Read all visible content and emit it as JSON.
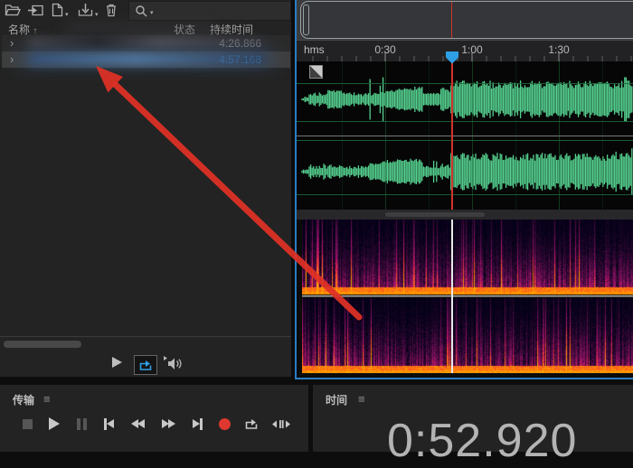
{
  "files_panel": {
    "toolbar": {
      "icons": [
        "open-file",
        "import-files",
        "new-item",
        "export",
        "delete",
        "search"
      ]
    },
    "header": {
      "name": "名称",
      "sort_indicator": "↑",
      "status": "状态",
      "duration": "持续时间"
    },
    "rows": [
      {
        "expander": "›",
        "name_redacted": true,
        "duration": "4:26.866",
        "selected": false
      },
      {
        "expander": "›",
        "name_redacted": true,
        "duration": "4:57.168",
        "selected": true
      }
    ],
    "footer": {
      "buttons": [
        "play",
        "loop-playback",
        "auto-play-audio"
      ]
    }
  },
  "editor_panel": {
    "ruler": {
      "unit": "hms",
      "tick_labels": [
        "0:30",
        "1:00",
        "1:30"
      ]
    },
    "playhead_time_seconds": 52.92,
    "views": [
      "waveform",
      "spectrogram"
    ]
  },
  "transport_panel": {
    "title": "传输",
    "menu_icon": "≡",
    "buttons": [
      "stop",
      "play",
      "pause",
      "skip-to-start",
      "rewind",
      "fast-forward",
      "skip-to-end",
      "record",
      "loop",
      "move-playhead"
    ]
  },
  "time_panel": {
    "title": "时间",
    "menu_icon": "≡",
    "time_display": "0:52.920"
  },
  "annotation": {
    "type": "red-arrow",
    "from": [
      397,
      351
    ],
    "to": [
      107,
      74
    ],
    "color": "#E03226"
  },
  "colors": {
    "accent_blue": "#2E9FE6",
    "selected_duration_text": "#3FA2EC",
    "waveform_green": "#5ADB97",
    "record_red": "#DE3831",
    "focus_border_blue": "#2B7CC4",
    "panel_background": "#232323"
  }
}
